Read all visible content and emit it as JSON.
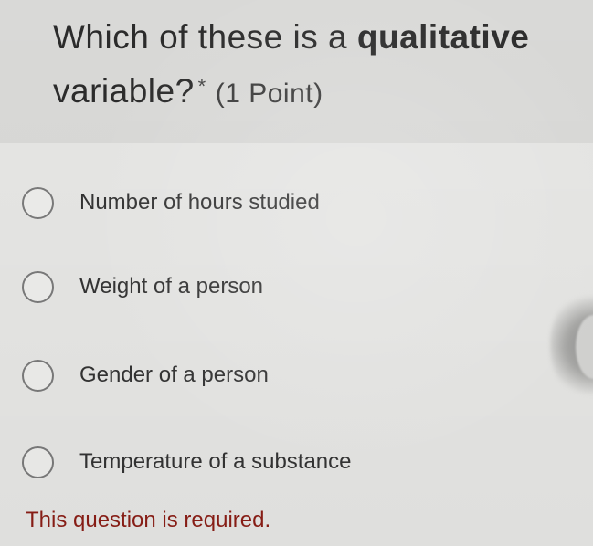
{
  "question": {
    "line1_prefix": "Which of these is a ",
    "line1_bold": "qualitative",
    "line2": "variable?",
    "required_marker": "*",
    "points": "(1 Point)"
  },
  "options": [
    {
      "label": "Number of hours studied",
      "selected": false
    },
    {
      "label": "Weight of a person",
      "selected": false
    },
    {
      "label": "Gender of a person",
      "selected": false
    },
    {
      "label": "Temperature of a substance",
      "selected": false
    }
  ],
  "validation": {
    "error_message": "This question is required."
  },
  "colors": {
    "error": "#8a1e16",
    "header_background": "#d9d9d7",
    "page_background": "#e6e6e4"
  },
  "icons": {
    "radio": "radio-unchecked-icon"
  }
}
